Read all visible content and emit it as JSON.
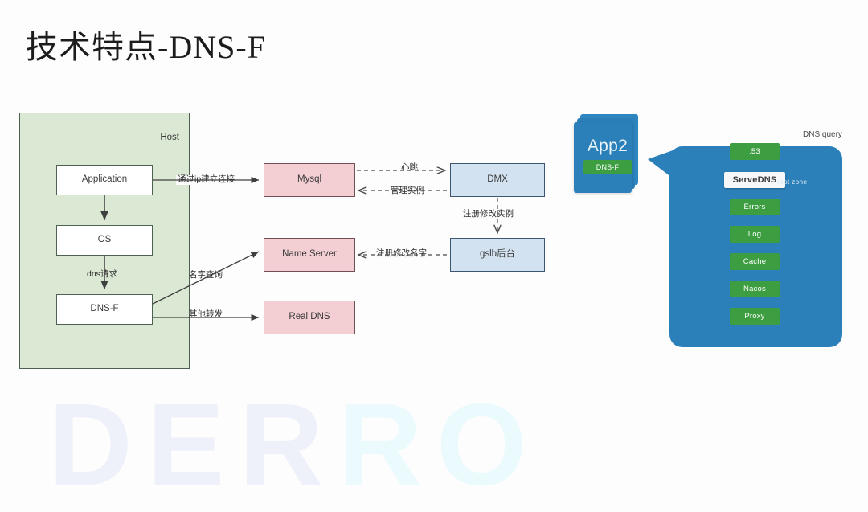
{
  "slide": {
    "title": "技术特点-DNS-F",
    "background_color": "#fdfdfd",
    "watermark": {
      "part1": "DER",
      "part2": "RO"
    }
  },
  "left_diagram": {
    "host_container": {
      "label": "Host",
      "fill_color": "#dbe8d4",
      "border_color": "#4d6152"
    },
    "nodes": [
      {
        "id": "application",
        "label": "Application",
        "style": "white"
      },
      {
        "id": "os",
        "label": "OS",
        "style": "white"
      },
      {
        "id": "dns-f",
        "label": "DNS-F",
        "style": "white"
      },
      {
        "id": "mysql",
        "label": "Mysql",
        "style": "pink"
      },
      {
        "id": "name-server",
        "label": "Name Server",
        "style": "pink"
      },
      {
        "id": "real-dns",
        "label": "Real DNS",
        "style": "pink"
      },
      {
        "id": "dmx",
        "label": "DMX",
        "style": "blue"
      },
      {
        "id": "gslb",
        "label": "gslb后台",
        "style": "blue"
      }
    ],
    "edge_labels": [
      {
        "id": "app-to-mysql",
        "text": "通过ip建立连接"
      },
      {
        "id": "os-to-dnsf",
        "text": "dns请求"
      },
      {
        "id": "dnsf-to-ns",
        "text": "名字查询"
      },
      {
        "id": "dnsf-to-realdns",
        "text": "其他转发"
      },
      {
        "id": "mysql-to-dmx",
        "text": "心跳"
      },
      {
        "id": "dmx-to-mysql",
        "text": "管理实例"
      },
      {
        "id": "dmx-to-gslb",
        "text": "注册修改实例"
      },
      {
        "id": "gslb-to-ns",
        "text": "注册修改名字"
      }
    ],
    "colors": {
      "pink_fill": "#f3cfd4",
      "pink_border": "#6f5055",
      "blue_fill": "#d3e2f0",
      "blue_border": "#3f5672",
      "white_fill": "#ffffff",
      "green_border": "#4d6152"
    }
  },
  "right_diagram": {
    "app_stack": {
      "label": "App2",
      "badge": "DNS-F"
    },
    "panel_color": "#2b80b9",
    "query_label": "DNS query",
    "root_zone_label": "root zone",
    "chain": [
      {
        "id": "port-53",
        "label": ":53",
        "style": "green"
      },
      {
        "id": "servedns",
        "label": "ServeDNS",
        "style": "white"
      },
      {
        "id": "errors",
        "label": "Errors",
        "style": "green"
      },
      {
        "id": "log",
        "label": "Log",
        "style": "green"
      },
      {
        "id": "cache",
        "label": "Cache",
        "style": "green"
      },
      {
        "id": "nacos",
        "label": "Nacos",
        "style": "green"
      },
      {
        "id": "proxy",
        "label": "Proxy",
        "style": "green"
      }
    ],
    "colors": {
      "green_fill": "#3c9d41",
      "white_fill": "#f6f7f9"
    }
  }
}
